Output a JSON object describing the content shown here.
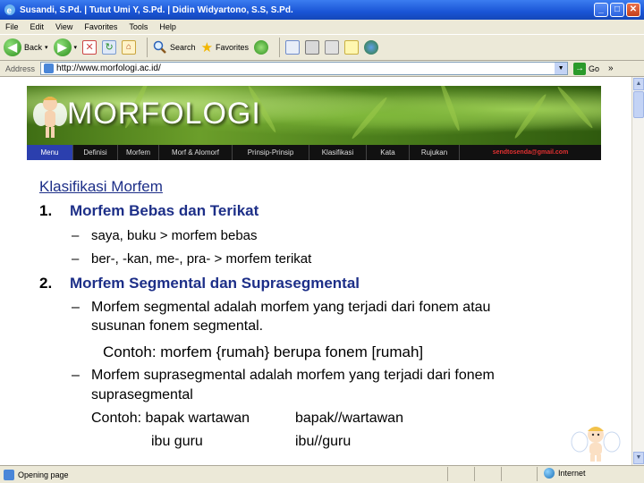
{
  "window": {
    "title": "Susandi, S.Pd. | Tutut Umi Y, S.Pd. | Didin Widyartono, S.S, S.Pd.",
    "minimize": "_",
    "maximize": "□",
    "close": "✕"
  },
  "menu": [
    "File",
    "Edit",
    "View",
    "Favorites",
    "Tools",
    "Help"
  ],
  "toolbar": {
    "back_label": "Back",
    "search_label": "Search",
    "favorites_label": "Favorites"
  },
  "address": {
    "label": "Address",
    "url": "http://www.morfologi.ac.id/",
    "go_label": "Go",
    "links_label": "»"
  },
  "banner": {
    "title": "MORFOLOGI"
  },
  "nav": {
    "items": [
      "Menu",
      "Definisi",
      "Morfem",
      "Morf & Alomorf",
      "Prinsip-Prinsip",
      "Klasifikasi",
      "Kata",
      "Rujukan"
    ],
    "email": "sendtosenda@gmail.com"
  },
  "content": {
    "heading": "Klasifikasi Morfem",
    "section1": {
      "num": "1.",
      "title": "Morfem Bebas dan Terikat"
    },
    "s1_items": [
      "saya, buku > morfem bebas",
      "ber-, -kan, me-, pra- > morfem terikat"
    ],
    "section2": {
      "num": "2.",
      "title": "Morfem Segmental dan Suprasegmental"
    },
    "s2_item1_line1": "Morfem segmental adalah morfem yang terjadi dari fonem atau",
    "s2_item1_line2": "susunan fonem segmental.",
    "s2_example1": "Contoh: morfem {rumah} berupa fonem [rumah]",
    "s2_item2_line1": "Morfem suprasegmental adalah morfem  yang terjadi dari fonem",
    "s2_item2_line2": "suprasegmental",
    "s2_example2_label": "Contoh: bapak wartawan",
    "s2_example2_value": "bapak//wartawan",
    "s2_example3_label": "ibu guru",
    "s2_example3_value": "ibu//guru",
    "dash": "–"
  },
  "status": {
    "text": "Opening page",
    "zone": "Internet"
  },
  "colors": {
    "title_bar": "#1a55d6",
    "nav_active": "#2b3fae",
    "heading": "#1d2f88",
    "email": "#e23131"
  }
}
